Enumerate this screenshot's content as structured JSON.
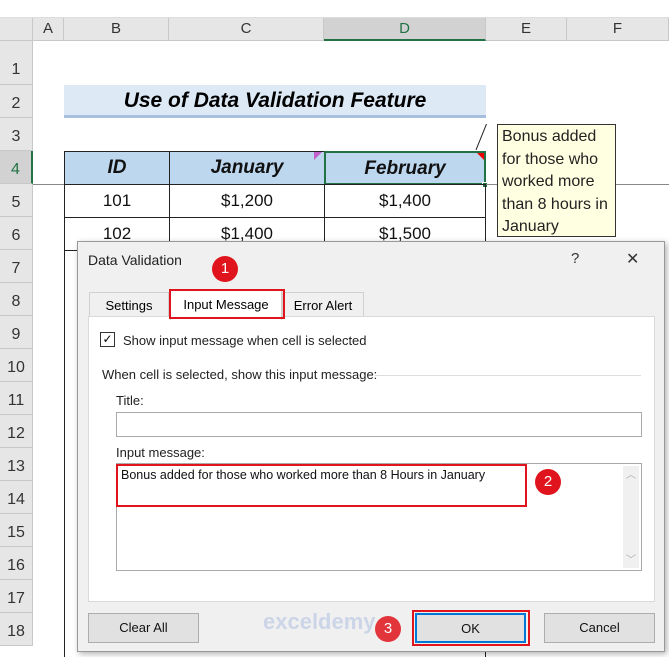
{
  "columns": [
    "A",
    "B",
    "C",
    "D",
    "E",
    "F"
  ],
  "rows": [
    "1",
    "2",
    "3",
    "4",
    "5",
    "6",
    "7",
    "8",
    "9",
    "10",
    "11",
    "12",
    "13",
    "14",
    "15",
    "16",
    "17",
    "18"
  ],
  "sheet": {
    "title": "Use of Data Validation Feature",
    "headers": [
      "ID",
      "January",
      "February"
    ],
    "data": [
      [
        "101",
        "$1,200",
        "$1,400"
      ],
      [
        "102",
        "$1,400",
        "$1,500"
      ]
    ],
    "input_tooltip": "Bonus added for those who worked more than 8 hours in January"
  },
  "dialog": {
    "title": "Data Validation",
    "help": "?",
    "close": "✕",
    "tabs": [
      "Settings",
      "Input Message",
      "Error Alert"
    ],
    "checkbox_label": "Show input message when cell is selected",
    "checkbox_checked": true,
    "group_label": "When cell is selected, show this input message:",
    "title_label": "Title:",
    "title_value": "",
    "message_label": "Input message:",
    "message_value": "Bonus added for those who worked more than 8 Hours in January",
    "buttons": {
      "clear_all": "Clear All",
      "ok": "OK",
      "cancel": "Cancel"
    }
  },
  "badges": [
    "1",
    "2",
    "3"
  ],
  "watermark": "exceldemy",
  "colors": {
    "header_fill": "#bdd7ee",
    "title_fill": "#dde9f5",
    "accent_red": "#e0141c",
    "selected_green": "#217346"
  }
}
